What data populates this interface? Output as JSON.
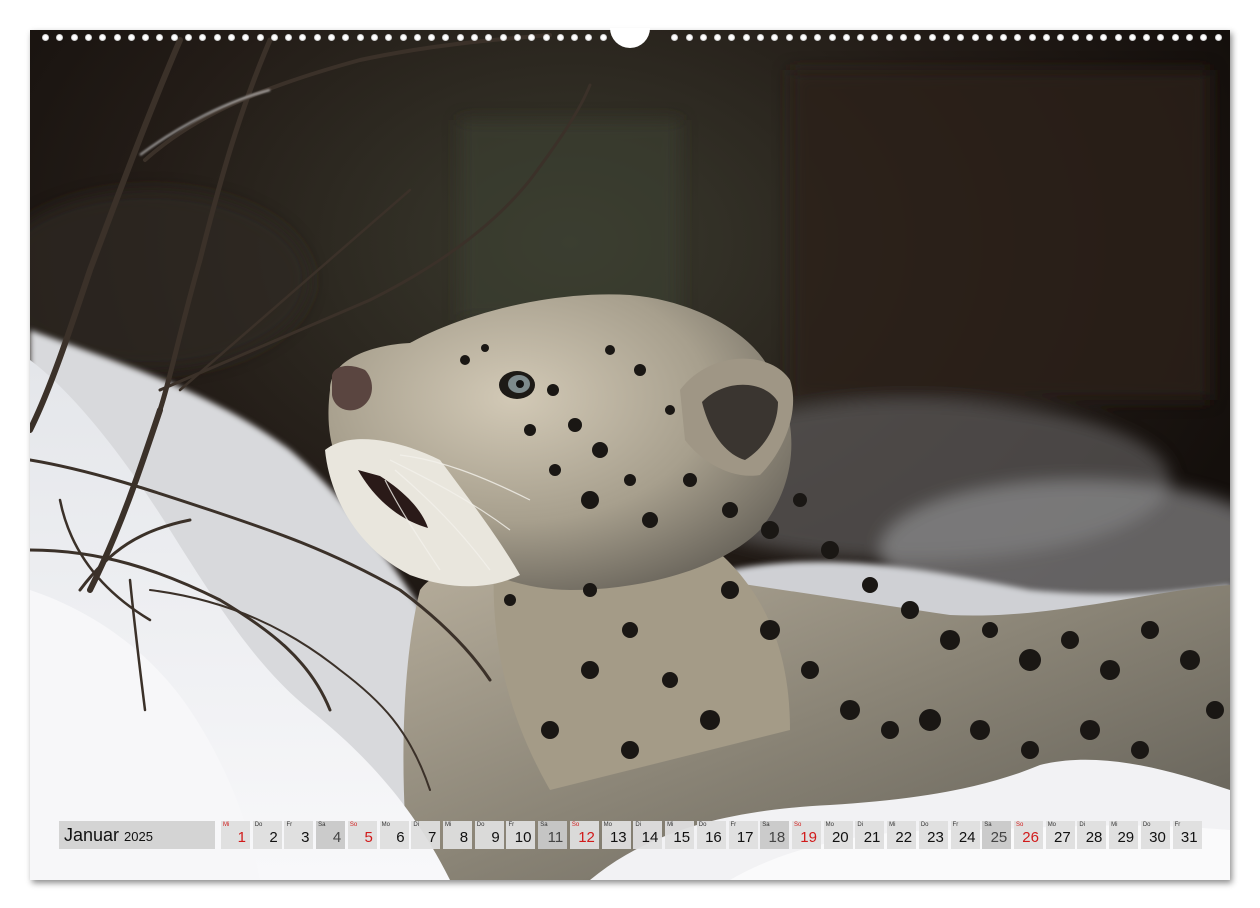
{
  "calendar": {
    "month": "Januar",
    "year": "2025",
    "days": [
      {
        "dn": "Mi",
        "dd": "1",
        "type": "holiday"
      },
      {
        "dn": "Do",
        "dd": "2",
        "type": "weekday"
      },
      {
        "dn": "Fr",
        "dd": "3",
        "type": "weekday"
      },
      {
        "dn": "Sa",
        "dd": "4",
        "type": "saturday"
      },
      {
        "dn": "So",
        "dd": "5",
        "type": "sunday"
      },
      {
        "dn": "Mo",
        "dd": "6",
        "type": "weekday"
      },
      {
        "dn": "Di",
        "dd": "7",
        "type": "weekday"
      },
      {
        "dn": "Mi",
        "dd": "8",
        "type": "weekday"
      },
      {
        "dn": "Do",
        "dd": "9",
        "type": "weekday"
      },
      {
        "dn": "Fr",
        "dd": "10",
        "type": "weekday"
      },
      {
        "dn": "Sa",
        "dd": "11",
        "type": "saturday"
      },
      {
        "dn": "So",
        "dd": "12",
        "type": "sunday"
      },
      {
        "dn": "Mo",
        "dd": "13",
        "type": "weekday"
      },
      {
        "dn": "Di",
        "dd": "14",
        "type": "weekday"
      },
      {
        "dn": "Mi",
        "dd": "15",
        "type": "weekday"
      },
      {
        "dn": "Do",
        "dd": "16",
        "type": "weekday"
      },
      {
        "dn": "Fr",
        "dd": "17",
        "type": "weekday"
      },
      {
        "dn": "Sa",
        "dd": "18",
        "type": "saturday"
      },
      {
        "dn": "So",
        "dd": "19",
        "type": "sunday"
      },
      {
        "dn": "Mo",
        "dd": "20",
        "type": "weekday"
      },
      {
        "dn": "Di",
        "dd": "21",
        "type": "weekday"
      },
      {
        "dn": "Mi",
        "dd": "22",
        "type": "weekday"
      },
      {
        "dn": "Do",
        "dd": "23",
        "type": "weekday"
      },
      {
        "dn": "Fr",
        "dd": "24",
        "type": "weekday"
      },
      {
        "dn": "Sa",
        "dd": "25",
        "type": "saturday"
      },
      {
        "dn": "So",
        "dd": "26",
        "type": "sunday"
      },
      {
        "dn": "Mo",
        "dd": "27",
        "type": "weekday"
      },
      {
        "dn": "Di",
        "dd": "28",
        "type": "weekday"
      },
      {
        "dn": "Mi",
        "dd": "29",
        "type": "weekday"
      },
      {
        "dn": "Do",
        "dd": "30",
        "type": "weekday"
      },
      {
        "dn": "Fr",
        "dd": "31",
        "type": "weekday"
      }
    ]
  },
  "photo": {
    "subject": "snow-leopard",
    "colors": {
      "background_dark": "#1c1612",
      "snow": "#f2f2f4",
      "fur": "#8d887c",
      "spots": "#1a1714",
      "accent_red": "#d11a1a"
    }
  }
}
